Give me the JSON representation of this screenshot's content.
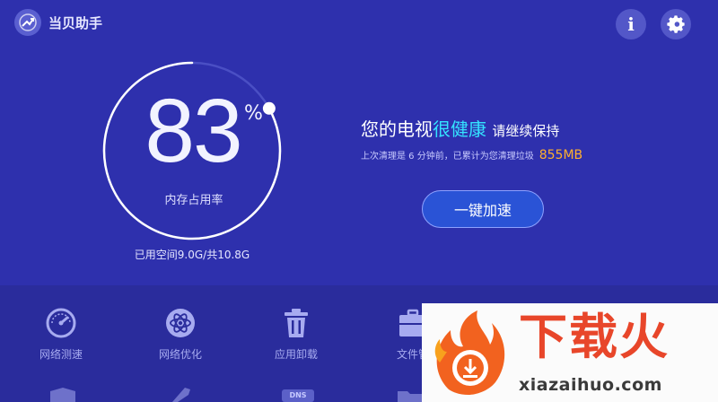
{
  "app": {
    "title": "当贝助手"
  },
  "header": {
    "info_label": "i"
  },
  "memory": {
    "percent": "83",
    "percent_symbol": "%",
    "usage_fraction": 0.83,
    "label": "内存占用率",
    "used_space": "已用空间9.0G/共10.8G"
  },
  "status": {
    "headline_part1": "您的电视",
    "headline_accent": "很健康",
    "headline_part2": "请继续保持",
    "subline": "上次清理是 6 分钟前，已累计为您清理垃圾",
    "cleaned_amount": "855MB"
  },
  "boost_button": {
    "label": "一键加速"
  },
  "tools": [
    {
      "label": "网络测速",
      "icon": "speedometer-icon"
    },
    {
      "label": "网络优化",
      "icon": "atom-icon"
    },
    {
      "label": "应用卸载",
      "icon": "trash-icon"
    },
    {
      "label": "文件管",
      "icon": "briefcase-icon"
    }
  ],
  "tools_row2": {
    "dns_label": "DNS"
  },
  "watermark": {
    "brand": "下载火",
    "url": "xiazaihuo.com"
  },
  "colors": {
    "background": "#2e30ad",
    "accent_cyan": "#34e2ff",
    "accent_orange": "#ffb02e",
    "button": "#2a53d6"
  }
}
